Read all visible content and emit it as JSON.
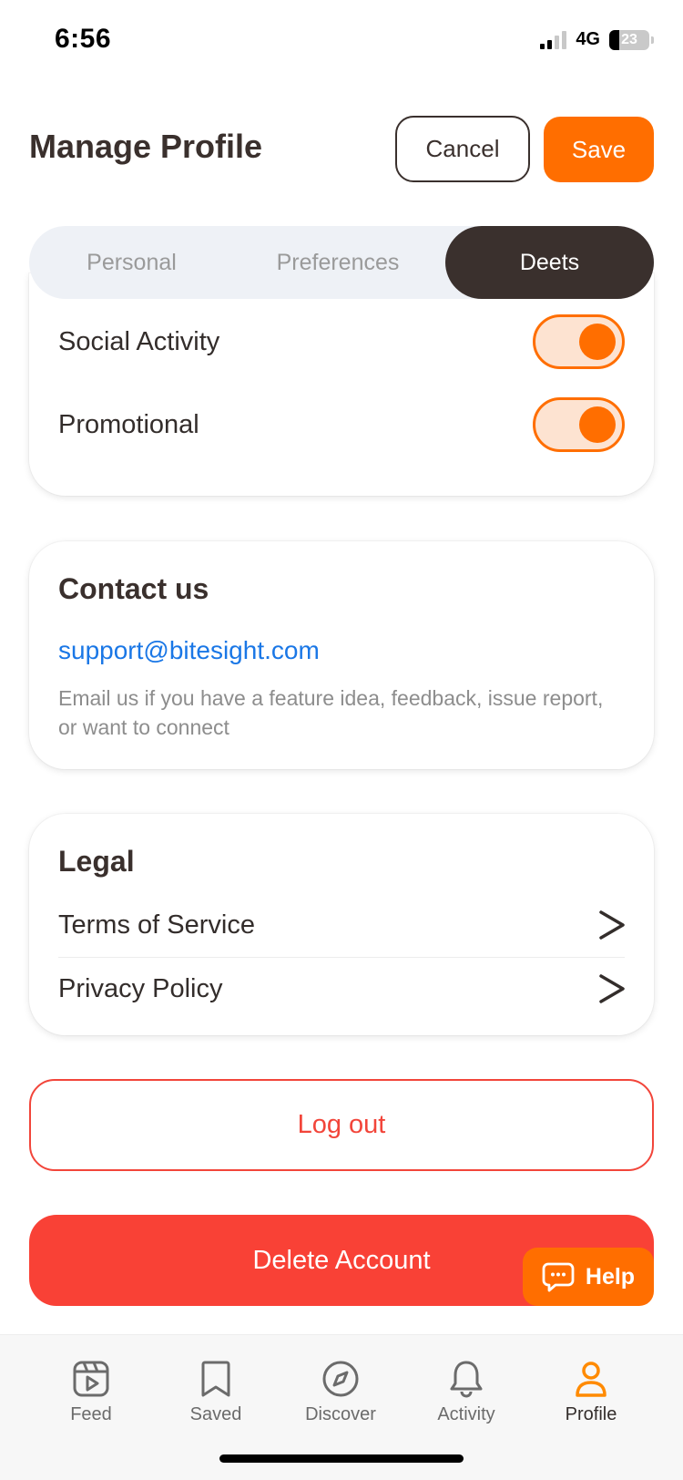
{
  "status_bar": {
    "time": "6:56",
    "network": "4G",
    "battery": "23"
  },
  "header": {
    "title": "Manage Profile",
    "cancel_label": "Cancel",
    "save_label": "Save"
  },
  "tabs": [
    {
      "label": "Personal",
      "active": false
    },
    {
      "label": "Preferences",
      "active": false
    },
    {
      "label": "Deets",
      "active": true
    }
  ],
  "notifications": [
    {
      "label": "Social Activity",
      "enabled": true
    },
    {
      "label": "Promotional",
      "enabled": true
    }
  ],
  "contact": {
    "title": "Contact us",
    "email": "support@bitesight.com",
    "description": "Email us if you have a feature idea, feedback, issue report, or want to connect"
  },
  "legal": {
    "title": "Legal",
    "items": [
      {
        "label": "Terms of Service",
        "icon": "chevron-right-icon"
      },
      {
        "label": "Privacy Policy",
        "icon": "chevron-right-icon"
      }
    ]
  },
  "actions": {
    "logout_label": "Log out",
    "delete_label": "Delete Account"
  },
  "help": {
    "label": "Help",
    "icon": "chat-bubble-icon"
  },
  "nav": [
    {
      "label": "Feed",
      "icon": "feed-icon",
      "active": false
    },
    {
      "label": "Saved",
      "icon": "bookmark-icon",
      "active": false
    },
    {
      "label": "Discover",
      "icon": "compass-icon",
      "active": false
    },
    {
      "label": "Activity",
      "icon": "bell-icon",
      "active": false
    },
    {
      "label": "Profile",
      "icon": "user-icon",
      "active": true
    }
  ],
  "colors": {
    "accent": "#ff6e00",
    "dark": "#3a302d",
    "link": "#1a77e6",
    "danger": "#f94136",
    "toggle_track": "#fde3d1"
  }
}
